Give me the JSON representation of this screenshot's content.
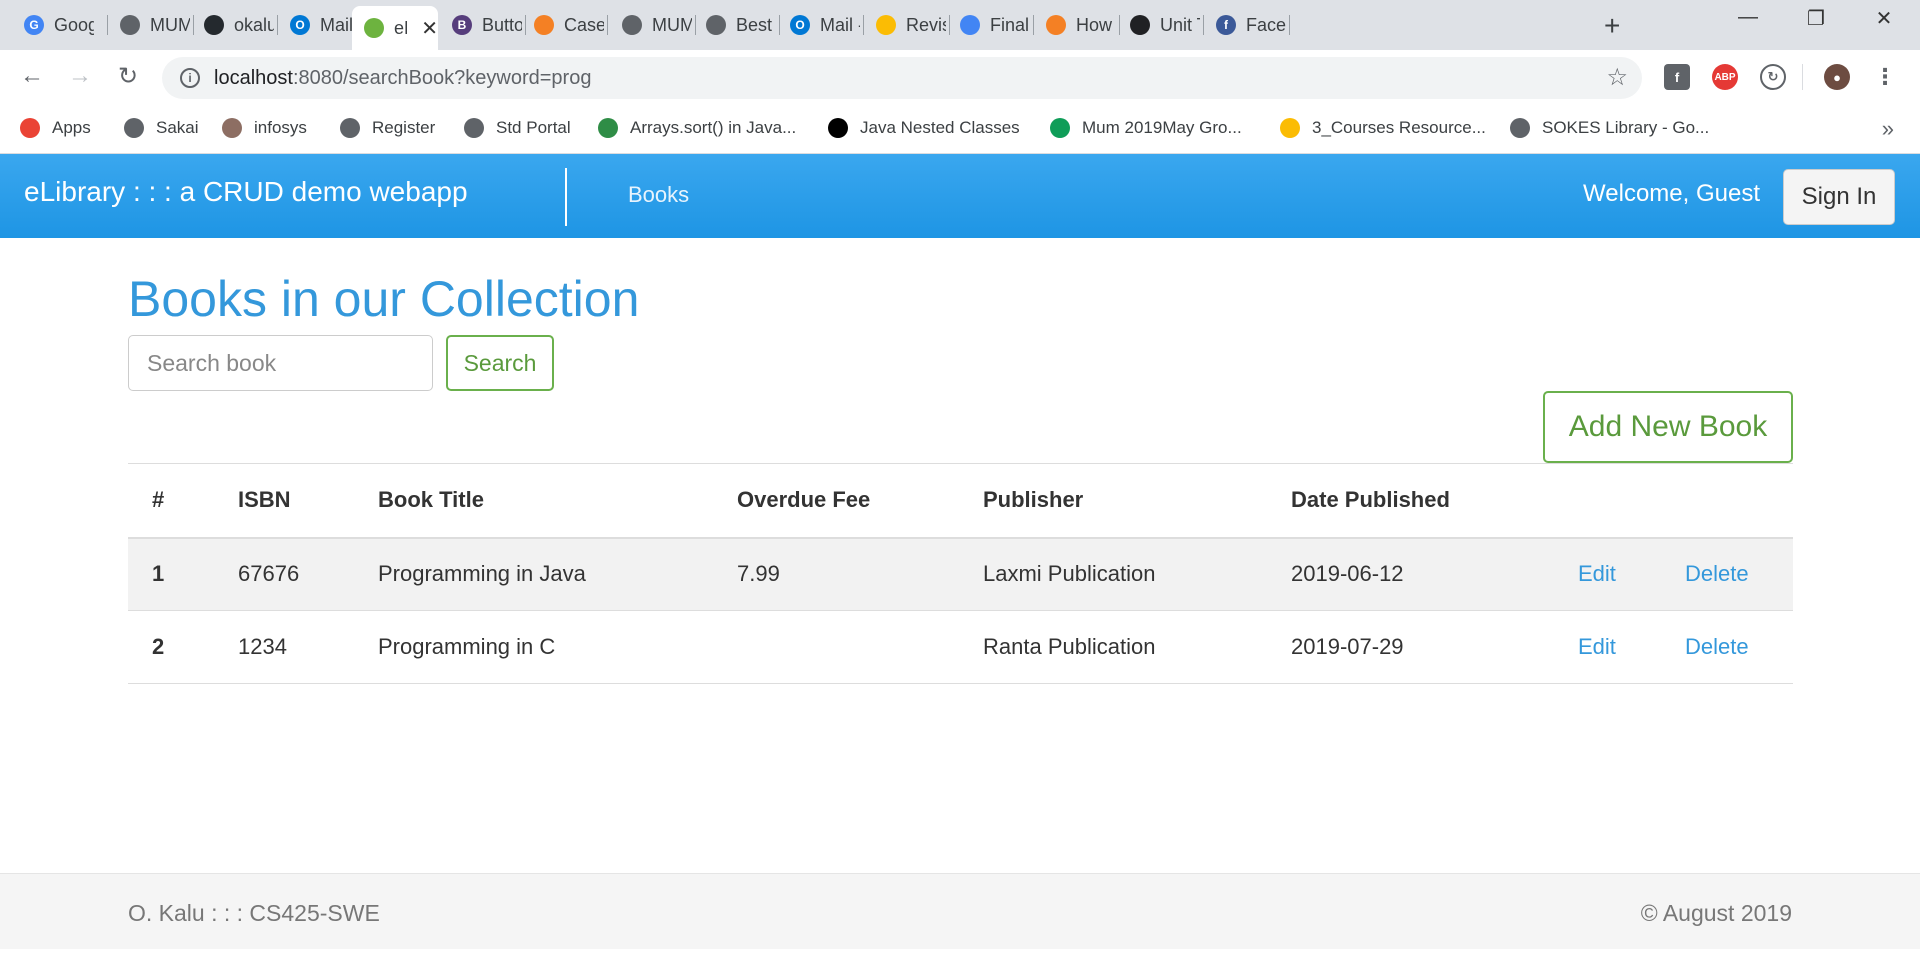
{
  "browser": {
    "tabs": [
      {
        "title": "Goog",
        "icon": "google-icon",
        "color": "#4285f4",
        "glyph": "G"
      },
      {
        "title": "MUM",
        "icon": "globe-icon",
        "color": "#5f6368",
        "glyph": ""
      },
      {
        "title": "okalu",
        "icon": "github-icon",
        "color": "#24292e",
        "glyph": ""
      },
      {
        "title": "Mail -",
        "icon": "outlook-icon",
        "color": "#0078d4",
        "glyph": "O"
      },
      {
        "title": "eL",
        "icon": "spring-leaf-icon",
        "color": "#6db33f",
        "glyph": "",
        "active": true
      },
      {
        "title": "Butto",
        "icon": "bootstrap-icon",
        "color": "#563d7c",
        "glyph": "B"
      },
      {
        "title": "Case",
        "icon": "stackoverflow-icon",
        "color": "#f48024",
        "glyph": ""
      },
      {
        "title": "MUM",
        "icon": "globe-icon",
        "color": "#5f6368",
        "glyph": ""
      },
      {
        "title": "Best F",
        "icon": "globe-icon",
        "color": "#5f6368",
        "glyph": ""
      },
      {
        "title": "Mail -",
        "icon": "outlook-icon",
        "color": "#0078d4",
        "glyph": "O"
      },
      {
        "title": "Revisi",
        "icon": "google-drive-icon",
        "color": "#fbbc04",
        "glyph": ""
      },
      {
        "title": "Final I",
        "icon": "google-docs-icon",
        "color": "#4285f4",
        "glyph": ""
      },
      {
        "title": "How s",
        "icon": "stackoverflow-icon",
        "color": "#f48024",
        "glyph": ""
      },
      {
        "title": "Unit T",
        "icon": "unit-test-icon",
        "color": "#202124",
        "glyph": ""
      },
      {
        "title": "Faceb",
        "icon": "facebook-icon",
        "color": "#3b5998",
        "glyph": "f"
      }
    ],
    "url_host": "localhost",
    "url_path": ":8080/searchBook?keyword=prog",
    "bookmarks": [
      {
        "label": "Apps",
        "icon": "apps-grid-icon",
        "color": "#ea4335"
      },
      {
        "label": "Sakai",
        "icon": "globe-icon",
        "color": "#5f6368"
      },
      {
        "label": "infosys",
        "icon": "infosys-icon",
        "color": "#8d6e63"
      },
      {
        "label": "Register",
        "icon": "globe-icon",
        "color": "#5f6368"
      },
      {
        "label": "Std Portal",
        "icon": "globe-icon",
        "color": "#5f6368"
      },
      {
        "label": "Arrays.sort() in Java...",
        "icon": "geeksforgeeks-icon",
        "color": "#2f8d46"
      },
      {
        "label": "Java Nested Classes",
        "icon": "j-icon",
        "color": "#000000"
      },
      {
        "label": "Mum 2019May Gro...",
        "icon": "google-sheets-plus-icon",
        "color": "#0f9d58"
      },
      {
        "label": "3_Courses Resource...",
        "icon": "google-drive-icon",
        "color": "#fbbc04"
      },
      {
        "label": "SOKES Library - Go...",
        "icon": "globe-icon",
        "color": "#5f6368"
      }
    ]
  },
  "app": {
    "brand": "eLibrary : : : a CRUD demo webapp",
    "nav_books": "Books",
    "welcome": "Welcome, Guest",
    "sign_in": "Sign In",
    "heading": "Books in our Collection",
    "search_placeholder": "Search book",
    "search_button": "Search",
    "add_button": "Add New Book",
    "columns": [
      "#",
      "ISBN",
      "Book Title",
      "Overdue Fee",
      "Publisher",
      "Date Published"
    ],
    "rows": [
      {
        "num": "1",
        "isbn": "67676",
        "title": "Programming in Java",
        "fee": "7.99",
        "publisher": "Laxmi Publication",
        "date": "2019-06-12",
        "edit": "Edit",
        "delete": "Delete"
      },
      {
        "num": "2",
        "isbn": "1234",
        "title": "Programming in C",
        "fee": "",
        "publisher": "Ranta Publication",
        "date": "2019-07-29",
        "edit": "Edit",
        "delete": "Delete"
      }
    ],
    "footer_left": "O. Kalu : : : CS425-SWE",
    "footer_right": "© August 2019"
  }
}
